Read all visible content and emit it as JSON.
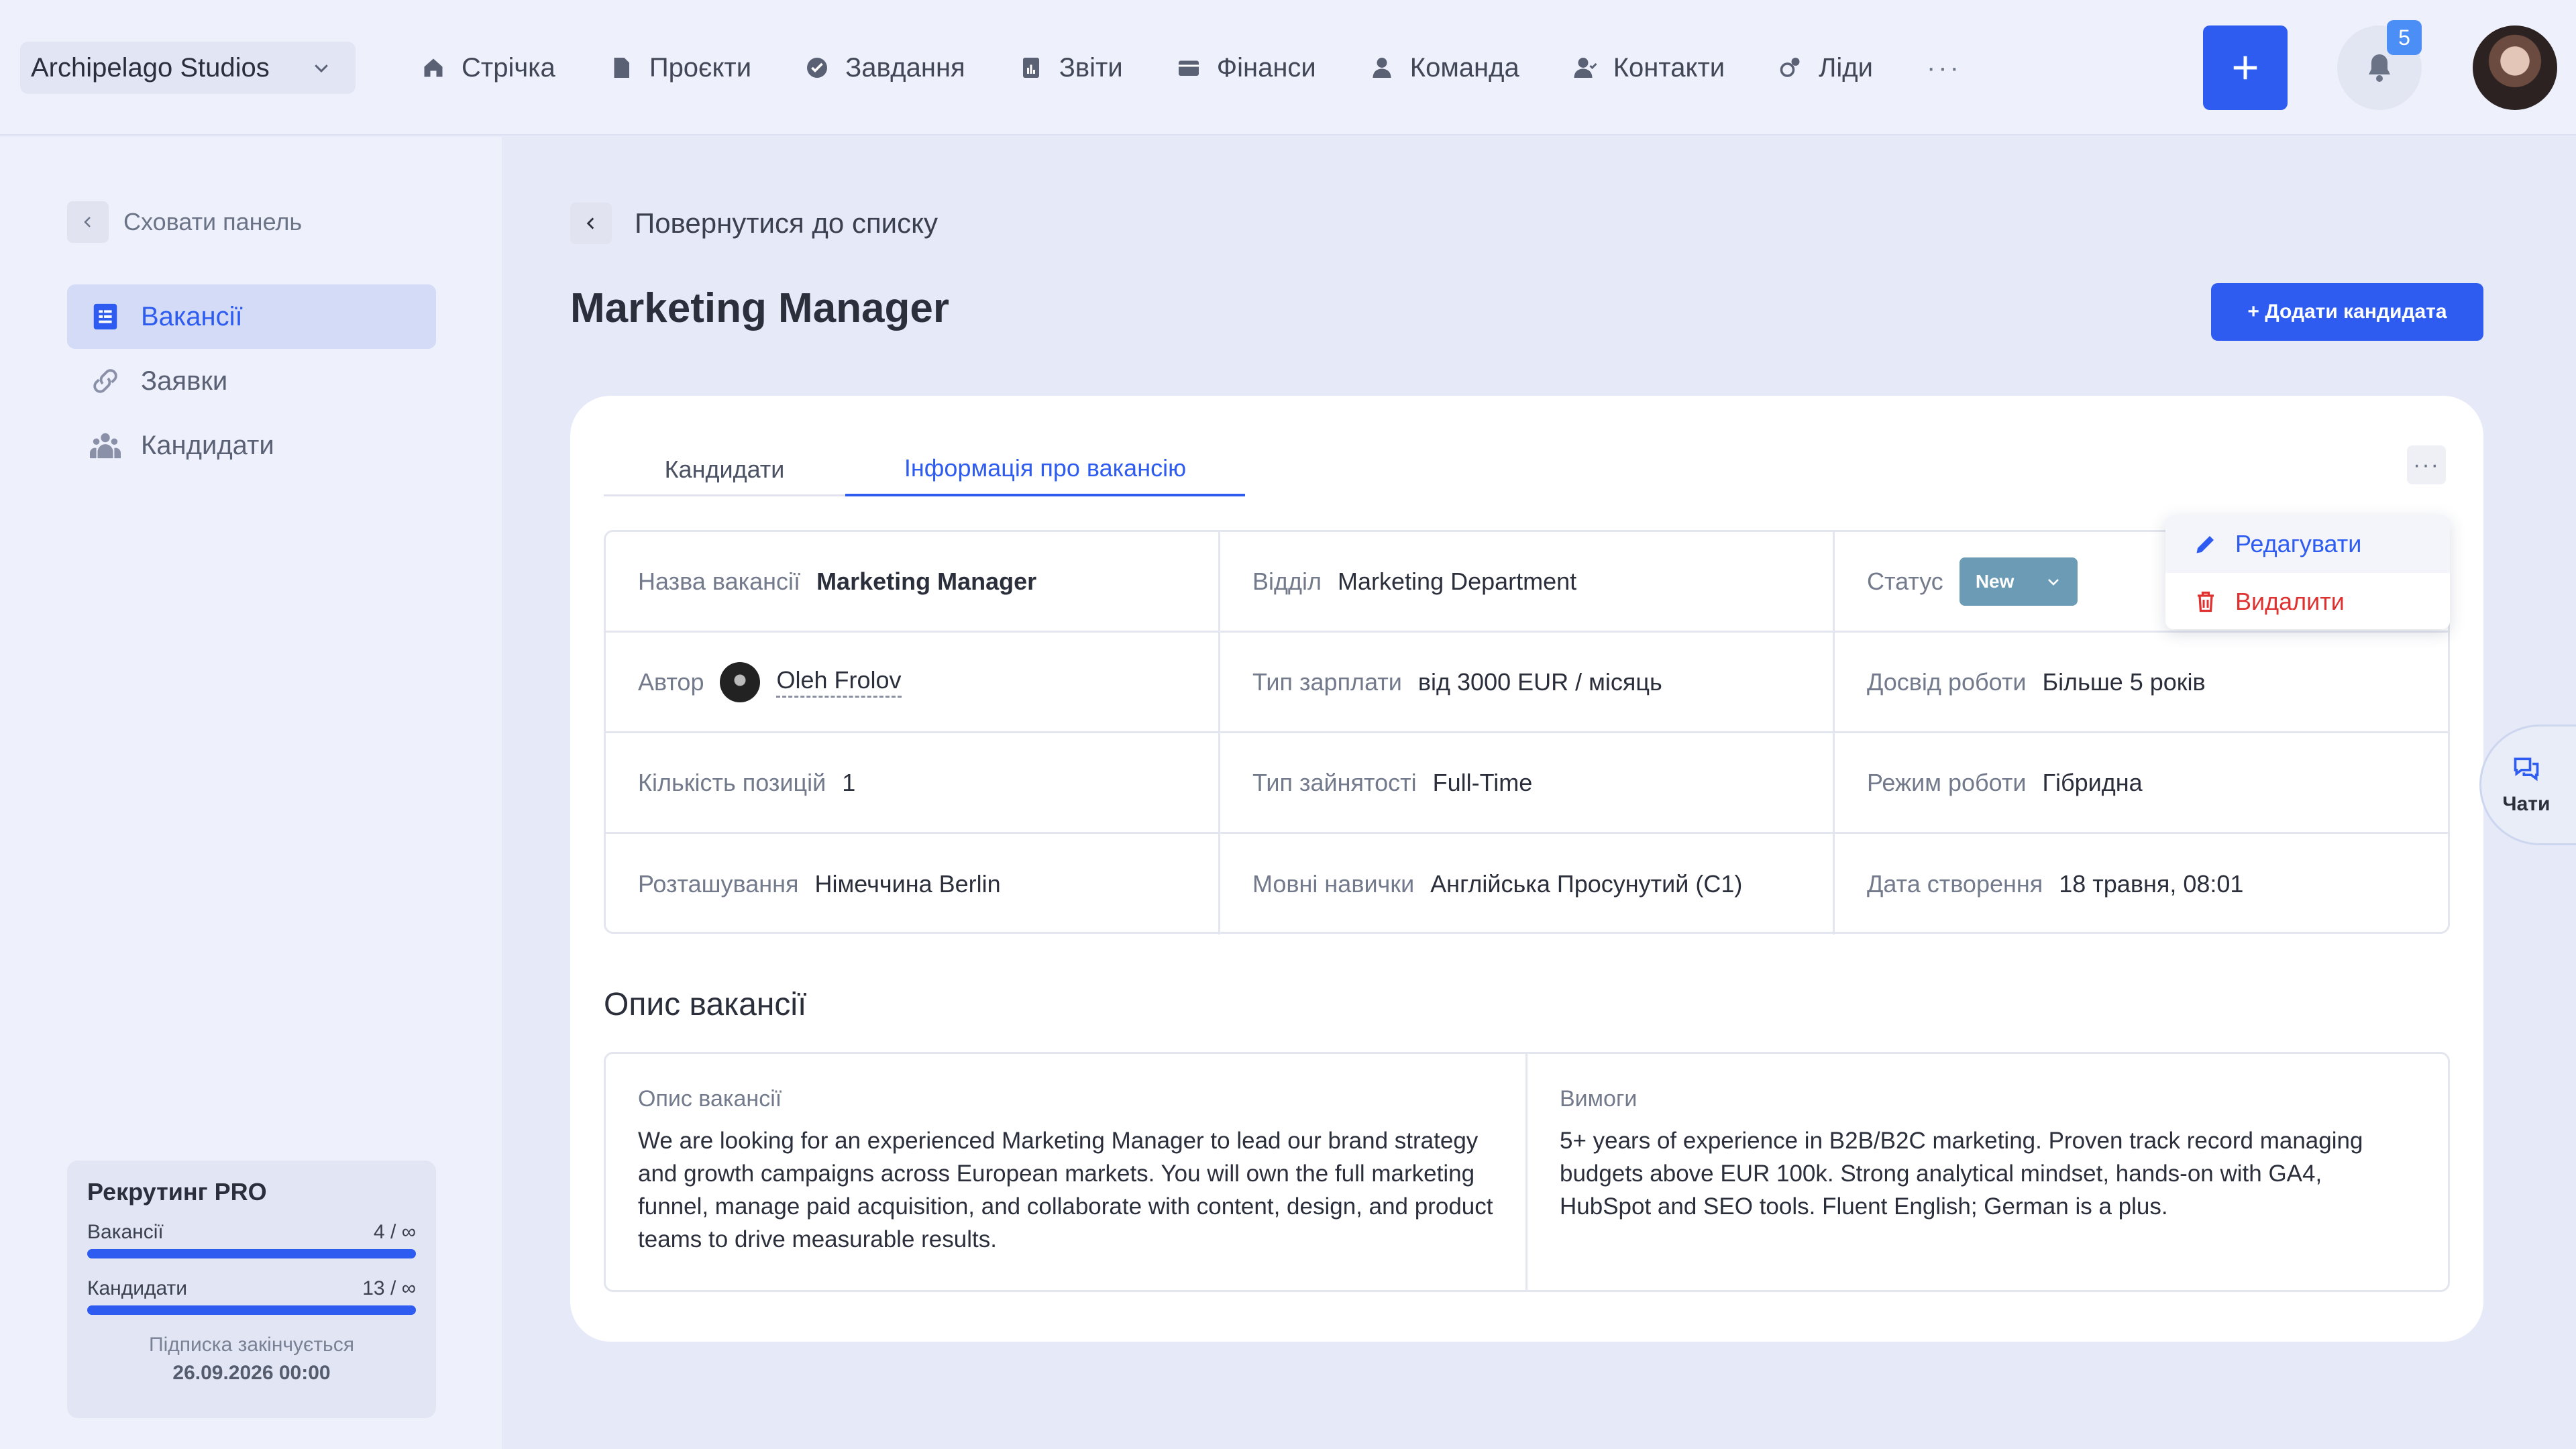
{
  "topbar": {
    "company": "Archipelago Studios",
    "nav": [
      {
        "label": "Стрічка",
        "icon": "home-icon"
      },
      {
        "label": "Проєкти",
        "icon": "file-icon"
      },
      {
        "label": "Завдання",
        "icon": "check-circle-icon"
      },
      {
        "label": "Звіти",
        "icon": "report-icon"
      },
      {
        "label": "Фінанси",
        "icon": "wallet-icon"
      },
      {
        "label": "Команда",
        "icon": "person-icon"
      },
      {
        "label": "Контакти",
        "icon": "contacts-icon"
      },
      {
        "label": "Ліди",
        "icon": "leads-icon"
      }
    ],
    "more": "···",
    "notifications_count": "5"
  },
  "sidebar": {
    "hide_label": "Сховати панель",
    "items": [
      {
        "label": "Вакансії",
        "icon": "vacancies-icon",
        "active": true
      },
      {
        "label": "Заявки",
        "icon": "link-icon",
        "active": false
      },
      {
        "label": "Кандидати",
        "icon": "people-icon",
        "active": false
      }
    ],
    "plan": {
      "title": "Рекрутинг PRO",
      "vacancies_label": "Вакансії",
      "vacancies_value": "4 / ∞",
      "candidates_label": "Кандидати",
      "candidates_value": "13 / ∞",
      "expires_note": "Підписка закінчується",
      "expires_date": "26.09.2026 00:00"
    }
  },
  "main": {
    "back_label": "Повернутися до списку",
    "title": "Marketing Manager",
    "add_candidate": "+ Додати кандидата",
    "tabs": [
      "Кандидати",
      "Інформація про вакансію"
    ],
    "more": "···",
    "info": {
      "name_label": "Назва вакансії",
      "name_value": "Marketing Manager",
      "dept_label": "Відділ",
      "dept_value": "Marketing Department",
      "status_label": "Статус",
      "status_value": "New",
      "author_label": "Автор",
      "author_value": "Oleh Frolov",
      "salary_label": "Тип зарплати",
      "salary_value": "від 3000 EUR / місяць",
      "exp_label": "Досвід роботи",
      "exp_value": "Більше 5 років",
      "positions_label": "Кількість позицій",
      "positions_value": "1",
      "employment_label": "Тип зайнятості",
      "employment_value": "Full-Time",
      "mode_label": "Режим роботи",
      "mode_value": "Гібридна",
      "location_label": "Розташування",
      "location_value": "Німеччина Berlin",
      "lang_label": "Мовні навички",
      "lang_value": "Англійська Просунутий (C1)",
      "created_label": "Дата створення",
      "created_value": "18 травня, 08:01"
    },
    "description": {
      "section_title": "Опис вакансії",
      "desc_label": "Опис вакансії",
      "desc_text": "We are looking for an experienced Marketing Manager to lead our brand strategy and growth campaigns across European markets. You will own the full marketing funnel, manage paid acquisition, and collaborate with content, design, and product teams to drive measurable results.",
      "req_label": "Вимоги",
      "req_text": "5+ years of experience in B2B/B2C marketing. Proven track record managing budgets above EUR 100k. Strong analytical mindset, hands-on with GA4, HubSpot and SEO tools. Fluent English; German is a plus."
    },
    "menu": {
      "edit": "Редагувати",
      "delete": "Видалити"
    }
  },
  "chats_label": "Чати",
  "colors": {
    "accent": "#2f5cf0",
    "danger": "#e03131",
    "status": "#6b9bb5"
  }
}
